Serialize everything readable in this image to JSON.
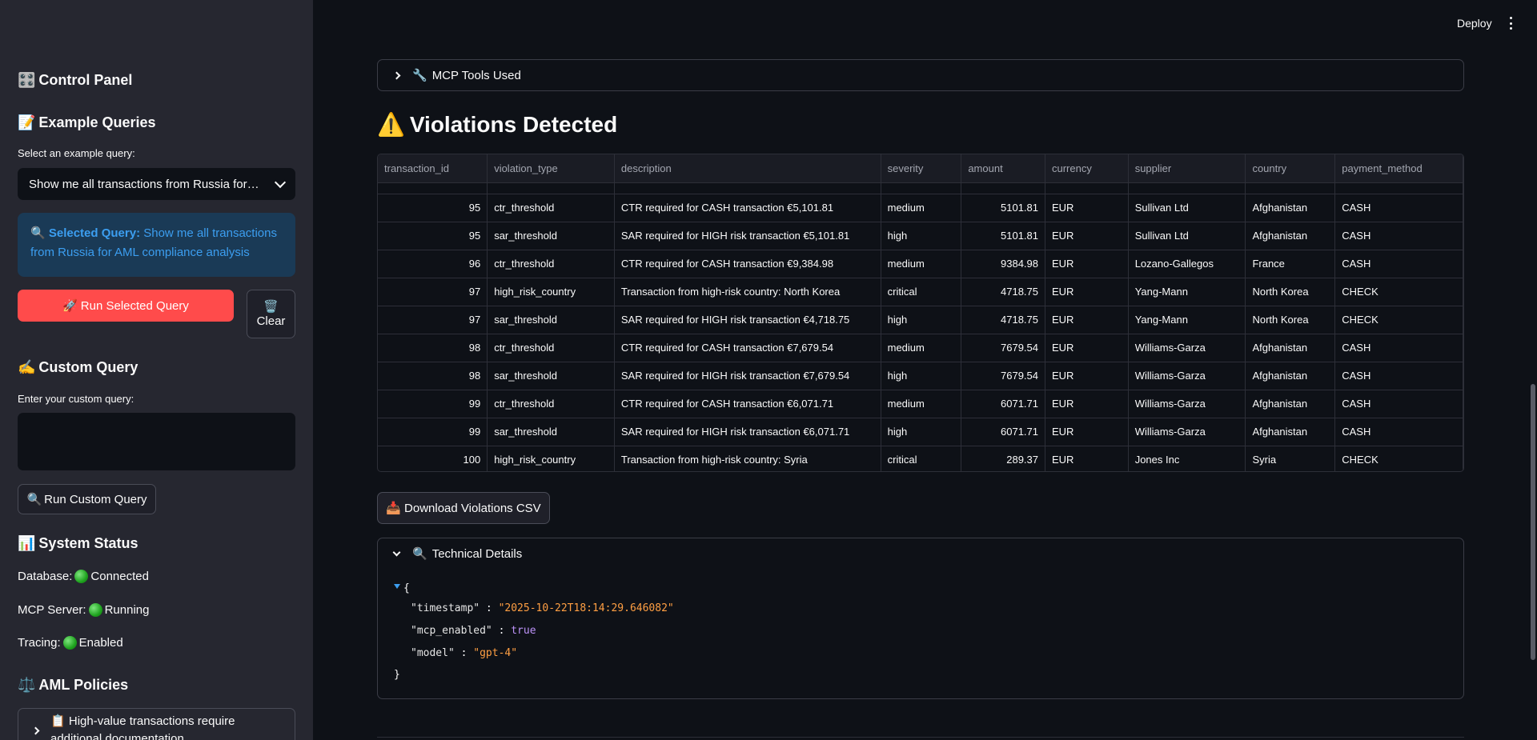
{
  "sidebar": {
    "control_panel_icon": "🎛️",
    "control_panel_title": "Control Panel",
    "example_queries_icon": "📝",
    "example_queries_title": "Example Queries",
    "select_label": "Select an example query:",
    "selected_value": "Show me all transactions from Russia for…",
    "info_icon": "🔍",
    "info_bold": "Selected Query:",
    "info_text": " Show me all transactions from Russia for AML compliance analysis",
    "run_selected_icon": "🚀",
    "run_selected_label": "Run Selected Query",
    "clear_icon": "🗑️",
    "clear_label": "Clear",
    "custom_query_icon": "✍️",
    "custom_query_title": "Custom Query",
    "custom_query_label": "Enter your custom query:",
    "custom_query_value": "",
    "run_custom_icon": "🔍",
    "run_custom_label": "Run Custom Query",
    "system_status_icon": "📊",
    "system_status_title": "System Status",
    "status": [
      {
        "label": "Database:",
        "value": "Connected"
      },
      {
        "label": "MCP Server:",
        "value": "Running"
      },
      {
        "label": "Tracing:",
        "value": "Enabled"
      }
    ],
    "aml_policies_icon": "⚖️",
    "aml_policies_title": "AML Policies",
    "policy_icon": "📋",
    "policy_text": "High-value transactions require additional documentation"
  },
  "header": {
    "deploy_label": "Deploy"
  },
  "main": {
    "mcp_tools_icon": "🔧",
    "mcp_tools_label": "MCP Tools Used",
    "violations_icon": "⚠️",
    "violations_title": "Violations Detected",
    "table": {
      "columns": [
        "transaction_id",
        "violation_type",
        "description",
        "severity",
        "amount",
        "currency",
        "supplier",
        "country",
        "payment_method"
      ],
      "rows": [
        [
          "95",
          "ctr_threshold",
          "CTR required for CASH transaction €5,101.81",
          "medium",
          "5101.81",
          "EUR",
          "Sullivan Ltd",
          "Afghanistan",
          "CASH"
        ],
        [
          "95",
          "sar_threshold",
          "SAR required for HIGH risk transaction €5,101.81",
          "high",
          "5101.81",
          "EUR",
          "Sullivan Ltd",
          "Afghanistan",
          "CASH"
        ],
        [
          "96",
          "ctr_threshold",
          "CTR required for CASH transaction €9,384.98",
          "medium",
          "9384.98",
          "EUR",
          "Lozano-Gallegos",
          "France",
          "CASH"
        ],
        [
          "97",
          "high_risk_country",
          "Transaction from high-risk country: North Korea",
          "critical",
          "4718.75",
          "EUR",
          "Yang-Mann",
          "North Korea",
          "CHECK"
        ],
        [
          "97",
          "sar_threshold",
          "SAR required for HIGH risk transaction €4,718.75",
          "high",
          "4718.75",
          "EUR",
          "Yang-Mann",
          "North Korea",
          "CHECK"
        ],
        [
          "98",
          "ctr_threshold",
          "CTR required for CASH transaction €7,679.54",
          "medium",
          "7679.54",
          "EUR",
          "Williams-Garza",
          "Afghanistan",
          "CASH"
        ],
        [
          "98",
          "sar_threshold",
          "SAR required for HIGH risk transaction €7,679.54",
          "high",
          "7679.54",
          "EUR",
          "Williams-Garza",
          "Afghanistan",
          "CASH"
        ],
        [
          "99",
          "ctr_threshold",
          "CTR required for CASH transaction €6,071.71",
          "medium",
          "6071.71",
          "EUR",
          "Williams-Garza",
          "Afghanistan",
          "CASH"
        ],
        [
          "99",
          "sar_threshold",
          "SAR required for HIGH risk transaction €6,071.71",
          "high",
          "6071.71",
          "EUR",
          "Williams-Garza",
          "Afghanistan",
          "CASH"
        ],
        [
          "100",
          "high_risk_country",
          "Transaction from high-risk country: Syria",
          "critical",
          "289.37",
          "EUR",
          "Jones Inc",
          "Syria",
          "CHECK"
        ]
      ]
    },
    "download_icon": "📥",
    "download_label": "Download Violations CSV",
    "tech_icon": "🔍",
    "tech_label": "Technical Details",
    "json": {
      "open_brace": "{",
      "close_brace": "}",
      "timestamp_key": "\"timestamp\"",
      "timestamp_val": "\"2025-10-22T18:14:29.646082\"",
      "mcp_key": "\"mcp_enabled\"",
      "mcp_val": "true",
      "model_key": "\"model\"",
      "model_val": "\"gpt-4\"",
      "sep": " : "
    }
  }
}
